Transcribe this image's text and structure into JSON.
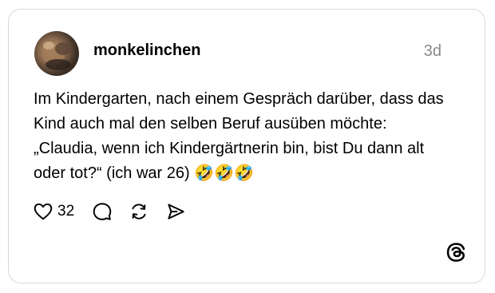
{
  "post": {
    "username": "monkelinchen",
    "time": "3d",
    "text": "Im Kindergarten, nach einem Gespräch darüber, dass das Kind auch mal den selben Beruf ausüben möchte: „Claudia, wenn ich Kindergärtnerin bin, bist Du dann alt oder tot?“ (ich war 26) 🤣🤣🤣",
    "like_count": "32"
  },
  "icons": {
    "like": "heart-icon",
    "reply": "comment-bubble-icon",
    "repost": "repost-icon",
    "share": "send-icon",
    "brand": "threads-logo-icon"
  },
  "colors": {
    "text": "#000000",
    "muted": "#8a8a8a",
    "border": "#d9d9d9"
  }
}
